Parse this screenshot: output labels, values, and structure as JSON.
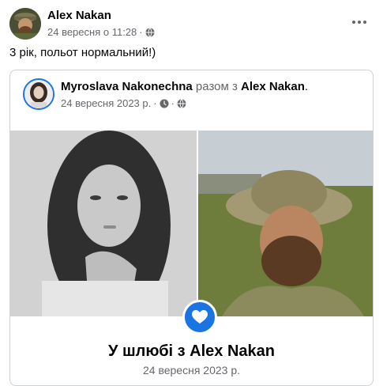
{
  "post": {
    "author": "Alex Nakan",
    "date": "24 вересня о 11:28",
    "separator": "·",
    "privacy_icon": "globe-icon",
    "text": "3 рік, польот нормальний!)"
  },
  "shared": {
    "author": "Myroslava Nakonechna",
    "with_text": "разом з",
    "partner": "Alex Nakan",
    "punct": ".",
    "date": "24 вересня 2023 р.",
    "separator1": "·",
    "separator2": "·",
    "icons": [
      "clock-icon",
      "globe-icon"
    ]
  },
  "event": {
    "title": "У шлюбі з Alex Nakan",
    "date": "24 вересня 2023 р.",
    "icon": "heart-icon"
  },
  "colors": {
    "accent": "#1b74e4",
    "text": "#050505",
    "secondary": "#65676b",
    "border": "#ced0d4"
  }
}
